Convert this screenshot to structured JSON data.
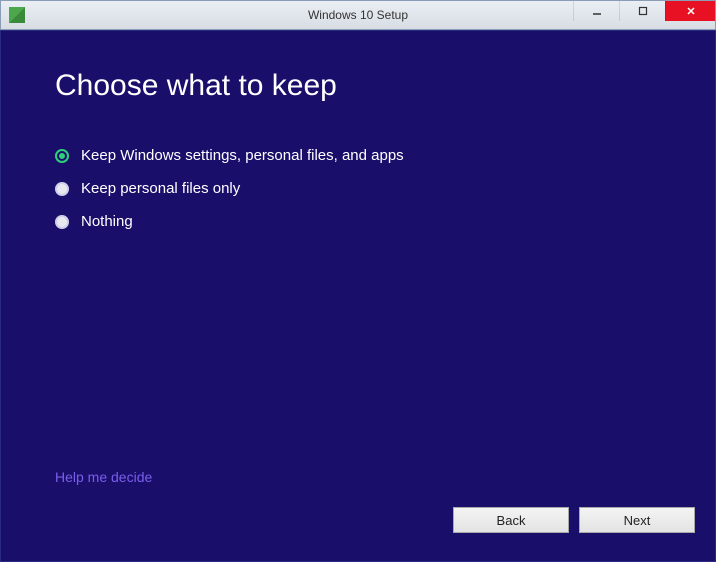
{
  "window": {
    "title": "Windows 10 Setup"
  },
  "heading": "Choose what to keep",
  "options": [
    {
      "label": "Keep Windows settings, personal files, and apps",
      "selected": true
    },
    {
      "label": "Keep personal files only",
      "selected": false
    },
    {
      "label": "Nothing",
      "selected": false
    }
  ],
  "help_link": "Help me decide",
  "buttons": {
    "back": "Back",
    "next": "Next"
  }
}
